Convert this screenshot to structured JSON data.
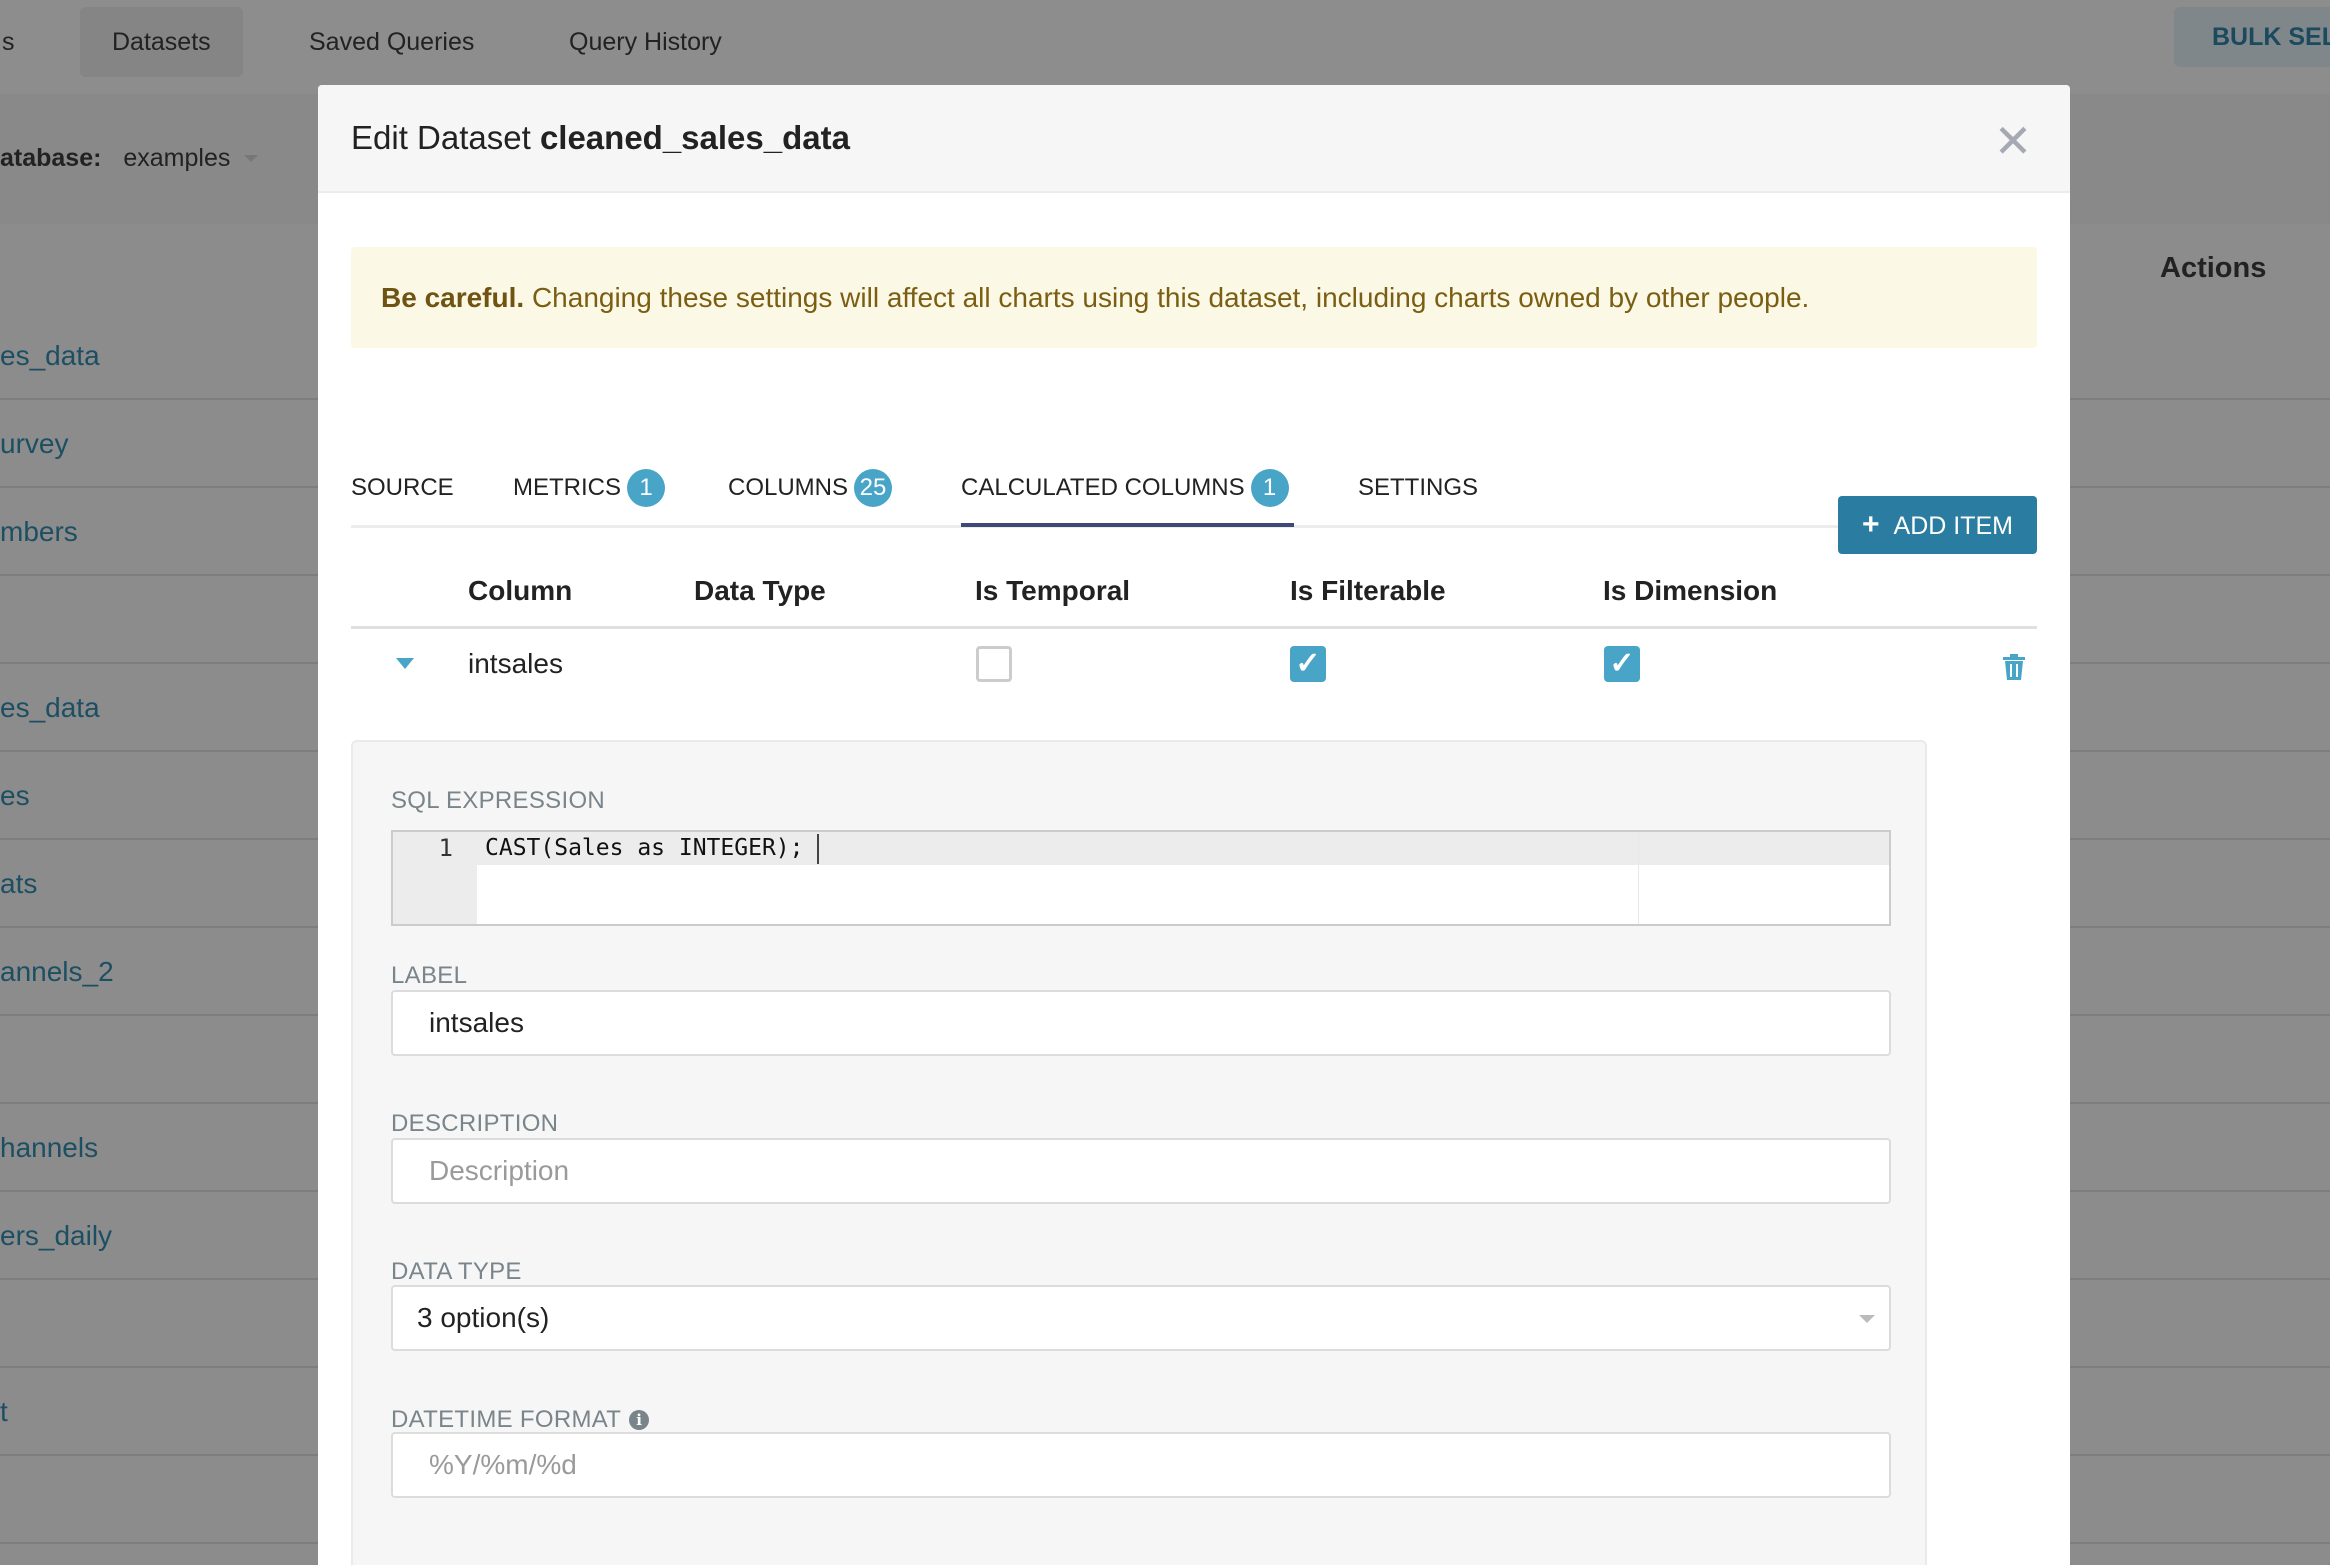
{
  "background": {
    "nav_tabs": [
      {
        "label": "s"
      },
      {
        "label": "Datasets",
        "active": true
      },
      {
        "label": "Saved Queries"
      },
      {
        "label": "Query History"
      }
    ],
    "bulk_select_label": "BULK SELE",
    "database_label": "atabase:",
    "database_value": "examples",
    "actions_header": "Actions",
    "rows": [
      "es_data",
      "urvey",
      "mbers",
      "",
      "es_data",
      "es",
      "ats",
      "annels_2",
      "",
      "hannels",
      "ers_daily",
      "",
      "t",
      ""
    ]
  },
  "modal": {
    "title_prefix": "Edit Dataset",
    "title_name": "cleaned_sales_data",
    "close_icon": "close-icon",
    "alert": {
      "strong": "Be careful.",
      "text": " Changing these settings will affect all charts using this dataset, including charts owned by other people."
    },
    "tabs": [
      {
        "label": "SOURCE"
      },
      {
        "label": "METRICS",
        "badge": "1"
      },
      {
        "label": "COLUMNS",
        "badge": "25"
      },
      {
        "label": "CALCULATED COLUMNS",
        "badge": "1",
        "active": true
      },
      {
        "label": "SETTINGS"
      }
    ],
    "add_item_label": "ADD ITEM",
    "table": {
      "headers": [
        "Column",
        "Data Type",
        "Is Temporal",
        "Is Filterable",
        "Is Dimension"
      ],
      "row": {
        "column": "intsales",
        "data_type": "",
        "is_temporal": false,
        "is_filterable": true,
        "is_dimension": true
      }
    },
    "details": {
      "sql_label": "SQL EXPRESSION",
      "sql_line_number": "1",
      "sql_code": "CAST(Sales as INTEGER);",
      "label_label": "LABEL",
      "label_value": "intsales",
      "description_label": "DESCRIPTION",
      "description_placeholder": "Description",
      "data_type_label": "DATA TYPE",
      "data_type_value": "3 option(s)",
      "datetime_format_label": "DATETIME FORMAT",
      "datetime_format_placeholder": "%Y/%m/%d"
    }
  },
  "colors": {
    "accent": "#48a5c8",
    "primary_button": "#2a7ca0",
    "tab_underline": "#3d4a78",
    "alert_bg": "#fcf8e6",
    "alert_text": "#7a5e12"
  }
}
